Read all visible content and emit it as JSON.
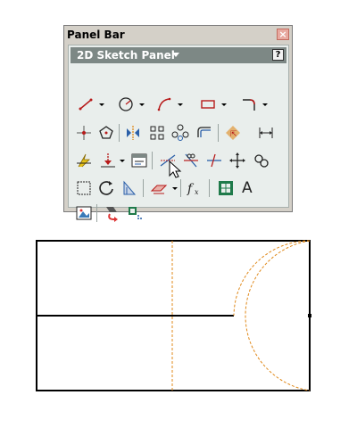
{
  "panel": {
    "title": "Panel Bar",
    "close_glyph": "×",
    "header_label": "2D Sketch Panel",
    "help_glyph": "?"
  },
  "tools": {
    "text_tool_glyph": "A",
    "fx_glyph": "f",
    "fx_sub": "x"
  },
  "colors": {
    "construction_line": "#e0891a",
    "sketch_line": "#000000",
    "header_bg": "#7d8885",
    "close_bg": "#e8a9a0"
  }
}
